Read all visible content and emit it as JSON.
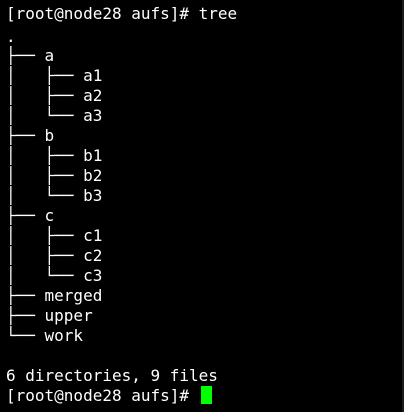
{
  "colors": {
    "background": "#000000",
    "text": "#ffffff",
    "cursor": "#00ff00"
  },
  "terminal": {
    "prompt_command": "[root@node28 aufs]# tree",
    "tree_lines": [
      ".",
      "├── a",
      "│   ├── a1",
      "│   ├── a2",
      "│   └── a3",
      "├── b",
      "│   ├── b1",
      "│   ├── b2",
      "│   └── b3",
      "├── c",
      "│   ├── c1",
      "│   ├── c2",
      "│   └── c3",
      "├── merged",
      "├── upper",
      "└── work"
    ],
    "summary": "6 directories, 9 files",
    "final_prompt": "[root@node28 aufs]#"
  }
}
